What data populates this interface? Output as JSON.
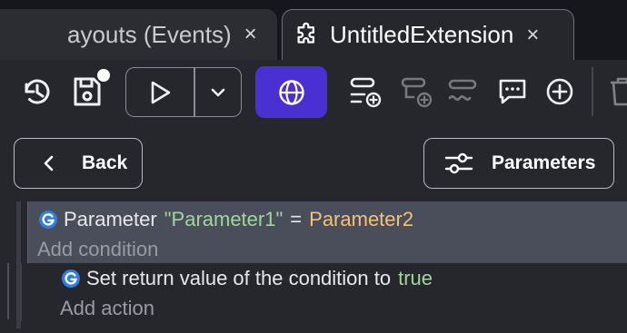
{
  "tabs": [
    {
      "label": "ayouts (Events)",
      "close": "×",
      "active": false
    },
    {
      "label": "UntitledExtension",
      "close": "×",
      "active": true
    }
  ],
  "toolbar": {
    "icons": [
      "history-icon",
      "save-icon",
      "play-icon",
      "chevron-down-icon",
      "globe-icon",
      "add-event-icon",
      "add-subevent-icon",
      "add-comment-icon",
      "chat-icon",
      "add-icon",
      "delete-icon"
    ],
    "accent_color": "#4a2fd3"
  },
  "buttons": {
    "back_label": "Back",
    "parameters_label": "Parameters"
  },
  "events": {
    "condition": {
      "prefix": "Parameter",
      "string_value": "\"Parameter1\"",
      "operator": "=",
      "right_value": "Parameter2"
    },
    "add_condition": "Add condition",
    "action": {
      "text": "Set return value of the condition to",
      "value": "true"
    },
    "add_action": "Add action"
  },
  "colors": {
    "background": "#26272d",
    "tab_bar": "#16171c",
    "condition_highlight": "#4a4e5a",
    "string_green": "#9fd79a",
    "number_orange": "#f2c27a"
  }
}
